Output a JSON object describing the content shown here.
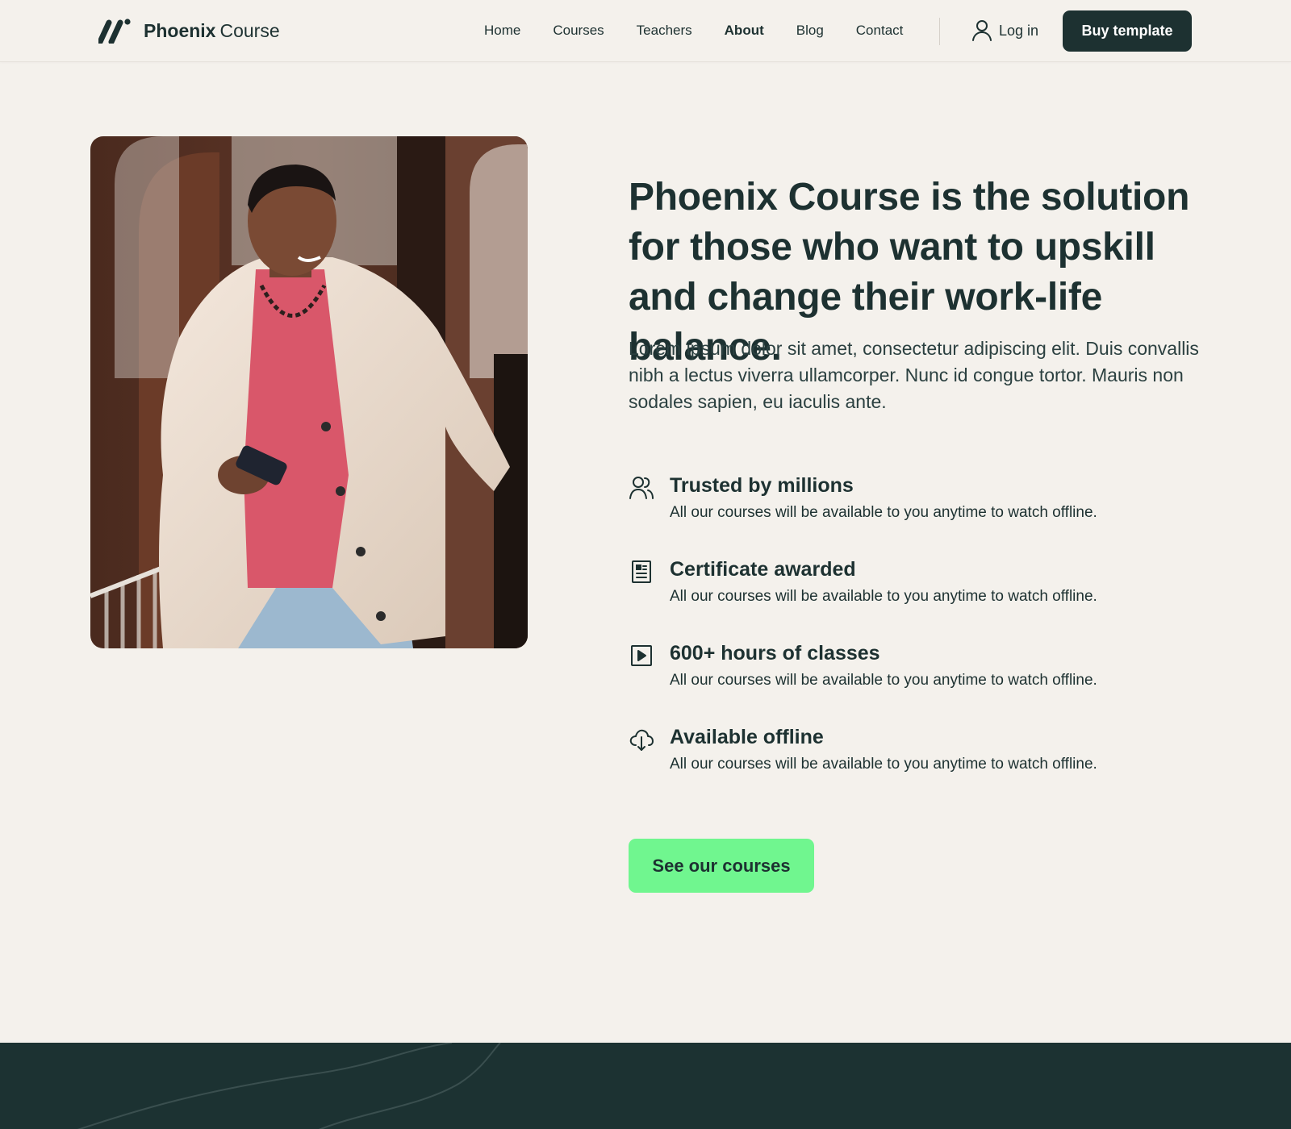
{
  "brand": {
    "name_strong": "Phoenix",
    "name_light": "Course",
    "logo_icon": "slash-logo-icon"
  },
  "nav": {
    "links": [
      {
        "label": "Home",
        "active": false
      },
      {
        "label": "Courses",
        "active": false
      },
      {
        "label": "Teachers",
        "active": false
      },
      {
        "label": "About",
        "active": true
      },
      {
        "label": "Blog",
        "active": false
      },
      {
        "label": "Contact",
        "active": false
      }
    ],
    "login_label": "Log in",
    "login_icon": "user-icon",
    "buy_label": "Buy template"
  },
  "hero": {
    "image_alt": "person-walking-photo",
    "headline": "Phoenix Course is the solution for those who want to upskill and change their work-life balance.",
    "lead": "Lorem ipsum dolor sit amet, consectetur adipiscing elit. Duis convallis nibh a lectus viverra ullamcorper. Nunc id congue tortor. Mauris non sodales sapien, eu iaculis ante."
  },
  "features": [
    {
      "icon": "users-icon",
      "title": "Trusted by millions",
      "desc": "All our courses will be available to you anytime to watch offline."
    },
    {
      "icon": "certificate-icon",
      "title": "Certificate awarded",
      "desc": "All our courses will be available to you anytime to watch offline."
    },
    {
      "icon": "play-icon",
      "title": "600+ hours of classes",
      "desc": "All our courses will be available to you anytime to watch offline."
    },
    {
      "icon": "cloud-download-icon",
      "title": "Available offline",
      "desc": "All our courses will be available to you anytime to watch offline."
    }
  ],
  "cta": {
    "label": "See our courses"
  },
  "colors": {
    "background": "#f4f1ec",
    "primary_dark": "#1d3131",
    "accent_green": "#70f68f",
    "text": "#1d3131"
  }
}
